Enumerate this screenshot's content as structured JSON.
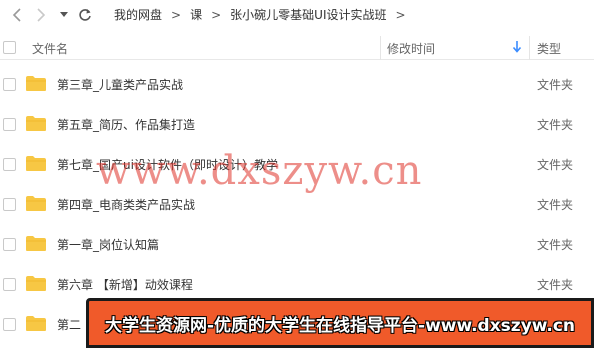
{
  "toolbar": {
    "back_icon": "chevron-left-icon",
    "forward_icon": "chevron-right-icon",
    "dropdown_icon": "caret-down-icon",
    "refresh_icon": "refresh-icon",
    "breadcrumb": [
      "我的网盘",
      "课",
      "张小碗儿零基础UI设计实战班"
    ],
    "separator": ">"
  },
  "header": {
    "name": "文件名",
    "date": "修改时间",
    "type": "类型",
    "sort_icon": "arrow-down-icon",
    "sort_color": "#3b8cff"
  },
  "files": [
    {
      "name": "第三章_儿童类产品实战",
      "type": "文件夹"
    },
    {
      "name": "第五章_简历、作品集打造",
      "type": "文件夹"
    },
    {
      "name": "第七章_国产ui设计软件（即时设计）教学",
      "type": "文件夹"
    },
    {
      "name": "第四章_电商类类产品实战",
      "type": "文件夹"
    },
    {
      "name": "第一章_岗位认知篇",
      "type": "文件夹"
    },
    {
      "name": "第六章 【新增】动效课程",
      "type": "文件夹"
    },
    {
      "name": "第二",
      "type": ""
    }
  ],
  "folder_color": "#f7c744",
  "watermark": "www.dxszyw.cn",
  "banner": {
    "text": "大学生资源网-优质的大学生在线指导平台-www.dxszyw.cn",
    "color": "#f05a2a"
  }
}
